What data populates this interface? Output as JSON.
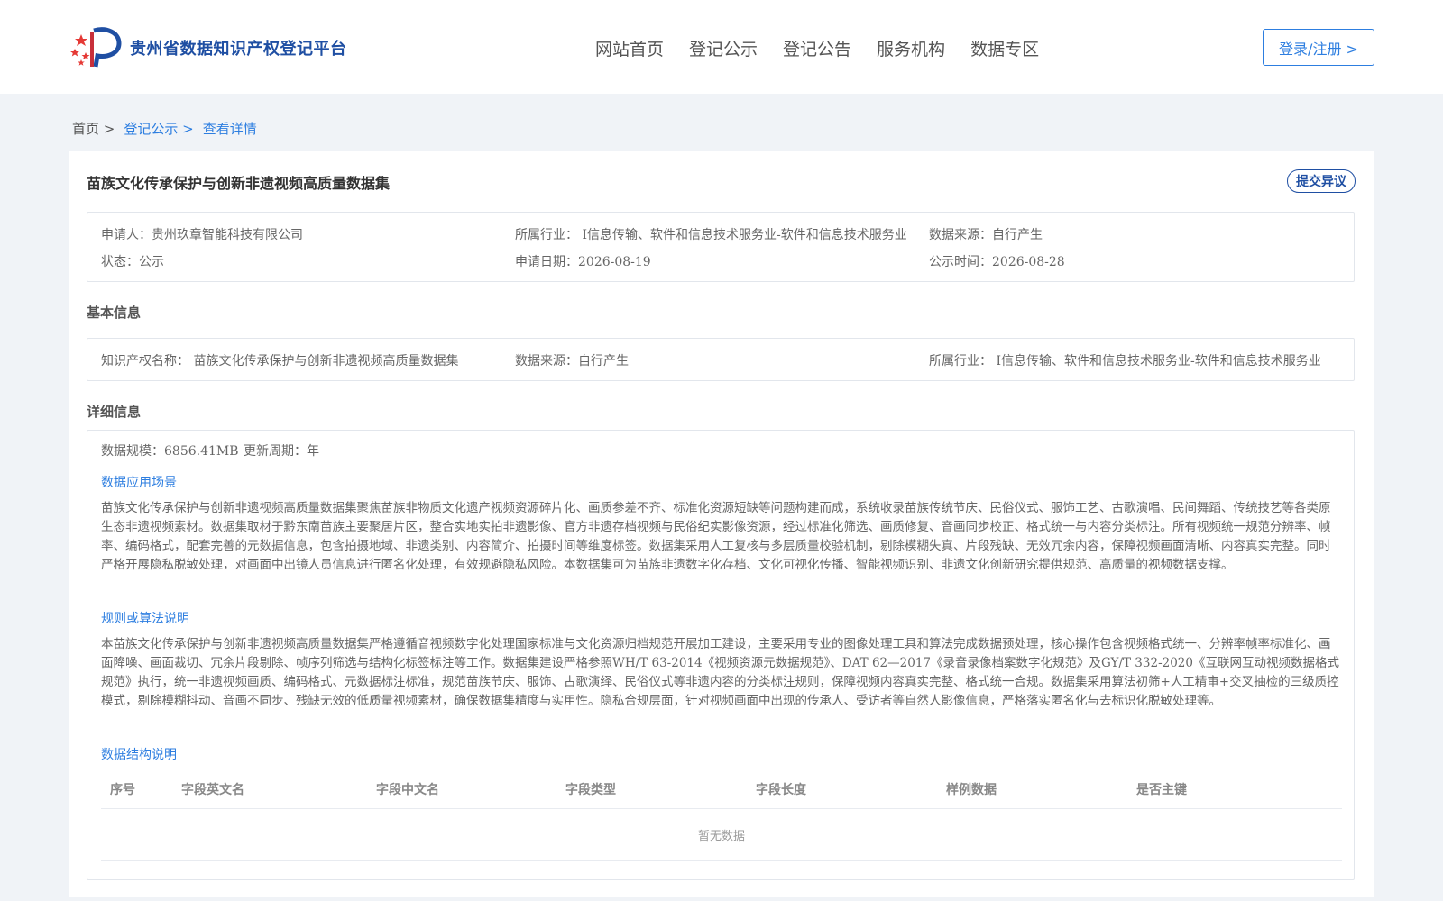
{
  "header": {
    "logo_text": "贵州省数据知识产权登记平台",
    "nav": [
      "网站首页",
      "登记公示",
      "登记公告",
      "服务机构",
      "数据专区"
    ],
    "login_label": "登录/注册 >"
  },
  "breadcrumb": {
    "home": "首页 >",
    "level1": "登记公示 >",
    "current": "查看详情"
  },
  "record": {
    "title": "苗族文化传承保护与创新非遗视频高质量数据集",
    "objection_label": "提交异议",
    "applicant": "申请人：贵州玖章智能科技有限公司",
    "industry": "所属行业： I信息传输、软件和信息技术服务业-软件和信息技术服务业",
    "source": "数据来源：自行产生",
    "status": "状态：公示",
    "apply_date": "申请日期：2026-08-19",
    "publish_date": "公示时间：2026-08-28"
  },
  "basic": {
    "section_title": "基本信息",
    "ip_name": "知识产权名称： 苗族文化传承保护与创新非遗视频高质量数据集",
    "source": "数据来源：自行产生",
    "industry": "所属行业： I信息传输、软件和信息技术服务业-软件和信息技术服务业"
  },
  "detail": {
    "section_title": "详细信息",
    "scale": "数据规模：6856.41MB",
    "cycle": "更新周期：年",
    "scene_title": "数据应用场景",
    "scene_text": "苗族文化传承保护与创新非遗视频高质量数据集聚焦苗族非物质文化遗产视频资源碎片化、画质参差不齐、标准化资源短缺等问题构建而成，系统收录苗族传统节庆、民俗仪式、服饰工艺、古歌演唱、民间舞蹈、传统技艺等各类原生态非遗视频素材。数据集取材于黔东南苗族主要聚居片区，整合实地实拍非遗影像、官方非遗存档视频与民俗纪实影像资源，经过标准化筛选、画质修复、音画同步校正、格式统一与内容分类标注。所有视频统一规范分辨率、帧率、编码格式，配套完善的元数据信息，包含拍摄地域、非遗类别、内容简介、拍摄时间等维度标签。数据集采用人工复核与多层质量校验机制，剔除模糊失真、片段残缺、无效冗余内容，保障视频画面清晰、内容真实完整。同时严格开展隐私脱敏处理，对画面中出镜人员信息进行匿名化处理，有效规避隐私风险。本数据集可为苗族非遗数字化存档、文化可视化传播、智能视频识别、非遗文化创新研究提供规范、高质量的视频数据支撑。",
    "rule_title": "规则或算法说明",
    "rule_text": "本苗族文化传承保护与创新非遗视频高质量数据集严格遵循音视频数字化处理国家标准与文化资源归档规范开展加工建设，主要采用专业的图像处理工具和算法完成数据预处理，核心操作包含视频格式统一、分辨率帧率标准化、画面降噪、画面裁切、冗余片段剔除、帧序列筛选与结构化标签标注等工作。数据集建设严格参照WH/T 63-2014《视频资源元数据规范》、DAT 62—2017《录音录像档案数字化规范》及GY/T 332-2020《互联网互动视频数据格式规范》执行，统一非遗视频画质、编码格式、元数据标注标准，规范苗族节庆、服饰、古歌演绎、民俗仪式等非遗内容的分类标注规则，保障视频内容真实完整、格式统一合规。数据集采用算法初筛+人工精审+交叉抽检的三级质控模式，剔除模糊抖动、音画不同步、残缺无效的低质量视频素材，确保数据集精度与实用性。隐私合规层面，针对视频画面中出现的传承人、受访者等自然人影像信息，严格落实匿名化与去标识化脱敏处理等。",
    "struct_title": "数据结构说明",
    "table_headers": [
      "序号",
      "字段英文名",
      "字段中文名",
      "字段类型",
      "字段长度",
      "样例数据",
      "是否主键"
    ],
    "empty_text": "暂无数据"
  }
}
